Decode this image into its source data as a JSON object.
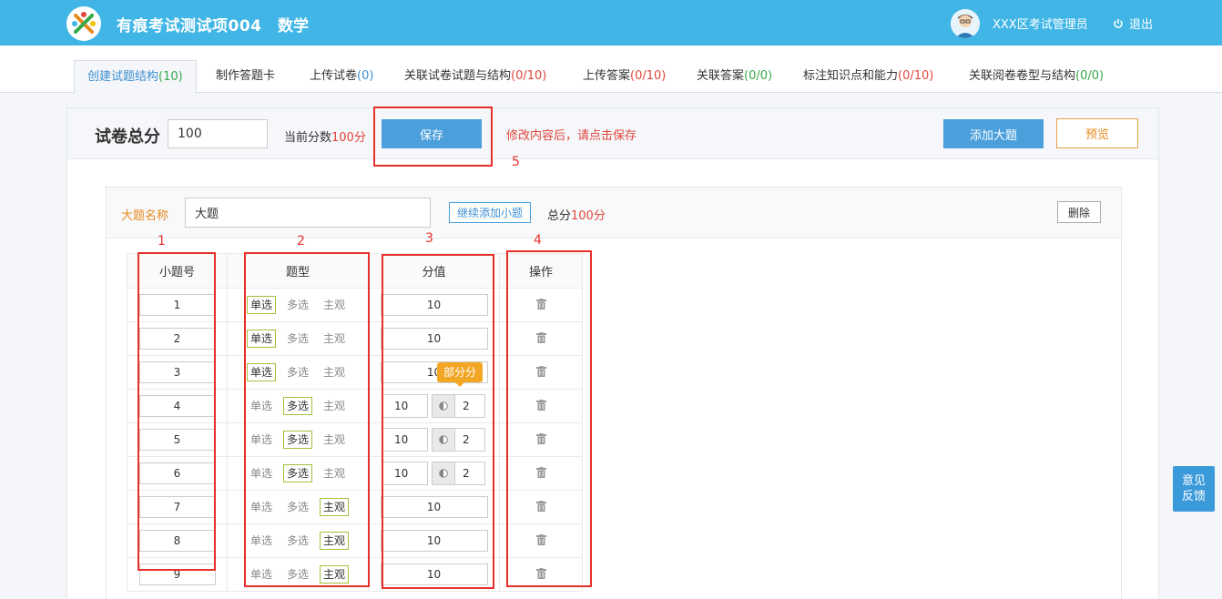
{
  "header": {
    "app_title": "有痕考试测试项004",
    "subject": "数学",
    "user_name": "XXX区考试管理员",
    "logout_label": "退出",
    "brand_color": "#41b6e6"
  },
  "tabs": [
    {
      "label": "创建试题结构",
      "count": "(10)",
      "count_color": "blue",
      "active": true
    },
    {
      "label": "制作答题卡",
      "count": "",
      "count_color": "",
      "active": false
    },
    {
      "label": "上传试卷",
      "count": "(0)",
      "count_color": "blue",
      "active": false
    },
    {
      "label": "关联试卷试题与结构",
      "count": "(0/10)",
      "count_color": "red",
      "active": false
    },
    {
      "label": "上传答案",
      "count": "(0/10)",
      "count_color": "red",
      "active": false
    },
    {
      "label": "关联答案",
      "count": "(0/0)",
      "count_color": "green",
      "active": false
    },
    {
      "label": "标注知识点和能力",
      "count": "(0/10)",
      "count_color": "red",
      "active": false
    },
    {
      "label": "关联阅卷卷型与结构",
      "count": "(0/0)",
      "count_color": "green",
      "active": false
    }
  ],
  "toolbar": {
    "total_label": "试卷总分",
    "total_value": "100",
    "current_prefix": "当前分数",
    "current_value": "100分",
    "save_label": "保存",
    "save_hint": "修改内容后，请点击保存",
    "add_big_label": "添加大题",
    "preview_label": "预览"
  },
  "section": {
    "name_label": "大题名称",
    "name_value": "大题",
    "add_small_label": "继续添加小题",
    "total_prefix": "总分",
    "total_value": "100分",
    "delete_label": "删除"
  },
  "table": {
    "headers": [
      "小题号",
      "题型",
      "分值",
      "操作"
    ],
    "type_options": [
      "单选",
      "多选",
      "主观"
    ],
    "tooltip": "部分分",
    "rows": [
      {
        "num": "1",
        "type": "单选",
        "score": "10",
        "partial": null
      },
      {
        "num": "2",
        "type": "单选",
        "score": "10",
        "partial": null
      },
      {
        "num": "3",
        "type": "单选",
        "score": "10",
        "partial": null
      },
      {
        "num": "4",
        "type": "多选",
        "score": "10",
        "partial": "2"
      },
      {
        "num": "5",
        "type": "多选",
        "score": "10",
        "partial": "2"
      },
      {
        "num": "6",
        "type": "多选",
        "score": "10",
        "partial": "2"
      },
      {
        "num": "7",
        "type": "主观",
        "score": "10",
        "partial": null
      },
      {
        "num": "8",
        "type": "主观",
        "score": "10",
        "partial": null
      },
      {
        "num": "9",
        "type": "主观",
        "score": "10",
        "partial": null
      }
    ]
  },
  "annotations": [
    "1",
    "2",
    "3",
    "4",
    "5"
  ],
  "feedback": {
    "line1": "意见",
    "line2": "反馈"
  }
}
